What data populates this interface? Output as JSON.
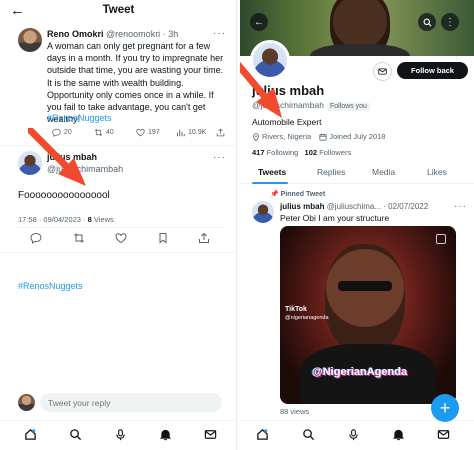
{
  "colors": {
    "accent": "#1d9bf0",
    "text": "#0f1419",
    "muted": "#536471",
    "arrow": "#f04b2e"
  },
  "tweet_screen": {
    "header": {
      "back_icon": "back-arrow-icon",
      "title": "Tweet"
    },
    "original_tweet": {
      "author_name": "Reno Omokri",
      "author_handle": "@renoomokri",
      "age": "· 3h",
      "more": "···",
      "text": "A woman can only get pregnant for a few days in a month. If you try to impregnate her outside that time, you are wasting your time. It is the same with wealth building. Opportunity only comes once in a while. If you fail to take advantage, you can't get wealthy!",
      "hashtag": "#RenosNuggets",
      "stats": {
        "replies": "20",
        "retweets": "40",
        "likes": "197",
        "views": "10.9K"
      }
    },
    "reply": {
      "author_name": "julius mbah",
      "author_handle": "@juliuschimambah",
      "more": "···",
      "text": "Foooooooooooooool",
      "timestamp": "17:58 · 09/04/2023 · ",
      "views_count": "8",
      "views_label": " Views"
    },
    "hashtag_repeat": "#RenosNuggets",
    "reply_placeholder": "Tweet your reply"
  },
  "profile_screen": {
    "name": "julius mbah",
    "handle": "@juliuschimambah",
    "follows_you": "Follows you",
    "bio": "Automobile Expert",
    "location": "Rivers, Nigeria",
    "joined": "Joined July 2018",
    "following_count": "417",
    "following_label": " Following",
    "followers_count": "102",
    "followers_label": " Followers",
    "follow_back": "Follow back",
    "tabs": [
      "Tweets",
      "Replies",
      "Media",
      "Likes"
    ],
    "pinned": {
      "label": "Pinned Tweet",
      "author_name": "julius mbah",
      "author_handle": "@juliuschima...",
      "date": "· 02/07/2022",
      "more": "···",
      "text": "Peter Obi I am your structure",
      "tiktok": "TikTok",
      "tiktok_handle": "@nigerianagenda",
      "watermark": "@NigerianAgenda",
      "views": "88 views"
    },
    "fab": "+"
  }
}
